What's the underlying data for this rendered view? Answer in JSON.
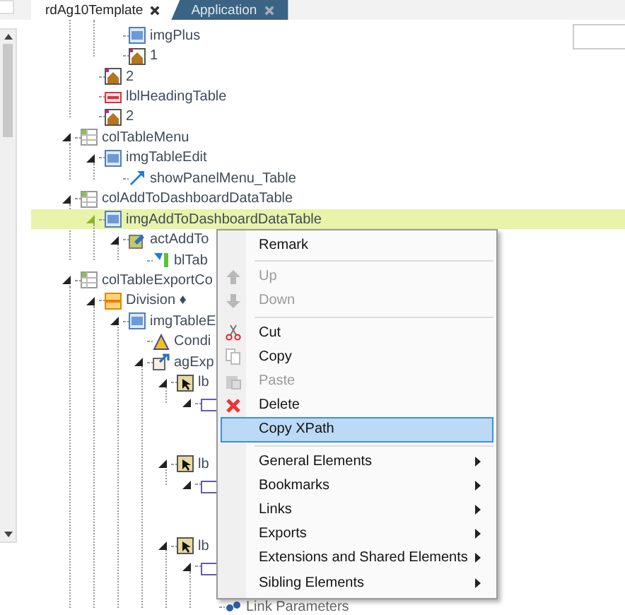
{
  "tabs": [
    {
      "label": "rdAg10Template",
      "selected": true
    },
    {
      "label": "Application",
      "selected": false
    }
  ],
  "tree": [
    {
      "children": [
        {
          "children": [
            {
              "label": "imgPlus",
              "kind": "image",
              "selected": false
            },
            {
              "label": "1",
              "kind": "include",
              "selected": false
            }
          ]
        },
        {
          "label": "2",
          "kind": "include",
          "selected": false
        },
        {
          "label": "lblHeadingTable",
          "kind": "label",
          "selected": false
        },
        {
          "label": "2",
          "kind": "include",
          "selected": false
        }
      ]
    },
    {
      "label": "colTableMenu",
      "kind": "column",
      "selected": false,
      "expanded": true,
      "children": [
        {
          "label": "imgTableEdit",
          "kind": "image",
          "selected": false,
          "expanded": true,
          "children": [
            {
              "label": "showPanelMenu_Table",
              "kind": "link",
              "selected": false
            }
          ]
        }
      ]
    },
    {
      "label": "colAddToDashboardDataTable",
      "kind": "column",
      "selected": false,
      "expanded": true,
      "children": [
        {
          "label": "imgAddToDashboardDataTable",
          "kind": "image",
          "selected": true,
          "expanded": true,
          "children": [
            {
              "label": "actAddTo",
              "kind": "action",
              "selected": false,
              "expanded": true,
              "children": [
                {
                  "label": "blTab",
                  "kind": "bookmark",
                  "selected": false
                }
              ]
            }
          ]
        }
      ]
    },
    {
      "label": "colTableExportCo",
      "kind": "column",
      "selected": false,
      "expanded": true,
      "children": [
        {
          "label": "Division ♦",
          "kind": "division",
          "selected": false,
          "expanded": true,
          "children": [
            {
              "label": "imgTableE",
              "kind": "image",
              "selected": false,
              "expanded": true,
              "children": [
                {
                  "label": "Condi",
                  "kind": "condition",
                  "selected": false
                },
                {
                  "label": "agExp",
                  "kind": "export",
                  "selected": false,
                  "expanded": true,
                  "children": [
                    {
                      "label": "lb",
                      "kind": "cell",
                      "selected": false,
                      "expanded": true,
                      "children": [
                        {
                          "kind": "target",
                          "expanded": true
                        }
                      ]
                    },
                    {
                      "label": "lb",
                      "kind": "cell",
                      "selected": false,
                      "expanded": true,
                      "children": [
                        {
                          "kind": "target",
                          "expanded": true
                        }
                      ]
                    },
                    {
                      "label": "lb",
                      "kind": "cell",
                      "selected": false,
                      "expanded": true,
                      "children": [
                        {
                          "kind": "target",
                          "expanded": true,
                          "children": [
                            {
                              "label": "Link Parameters",
                              "kind": "param",
                              "selected": false
                            }
                          ]
                        }
                      ]
                    }
                  ]
                }
              ]
            }
          ]
        }
      ]
    }
  ],
  "menu": [
    [
      {
        "label": "Remark",
        "kind": "plain",
        "disabled": false,
        "selected": false
      }
    ],
    [
      {
        "label": "Up",
        "kind": "up",
        "disabled": true,
        "selected": false
      },
      {
        "label": "Down",
        "kind": "down",
        "disabled": true,
        "selected": false
      }
    ],
    [
      {
        "label": "Cut",
        "kind": "cut",
        "disabled": false,
        "selected": false
      },
      {
        "label": "Copy",
        "kind": "copy",
        "disabled": false,
        "selected": false
      },
      {
        "label": "Paste",
        "kind": "paste",
        "disabled": true,
        "selected": false
      },
      {
        "label": "Delete",
        "kind": "delete",
        "disabled": false,
        "selected": false
      },
      {
        "label": "Copy XPath",
        "kind": "plain",
        "disabled": false,
        "selected": true
      }
    ],
    [
      {
        "label": "General Elements",
        "kind": "submenu",
        "disabled": false,
        "selected": false
      },
      {
        "label": "Bookmarks",
        "kind": "submenu",
        "disabled": false,
        "selected": false
      },
      {
        "label": "Links",
        "kind": "submenu",
        "disabled": false,
        "selected": false
      },
      {
        "label": "Exports",
        "kind": "submenu",
        "disabled": false,
        "selected": false
      },
      {
        "label": "Extensions and Shared Elements",
        "kind": "submenu",
        "disabled": false,
        "selected": false
      },
      {
        "label": "Sibling Elements",
        "kind": "submenu",
        "disabled": false,
        "selected": false
      }
    ]
  ]
}
